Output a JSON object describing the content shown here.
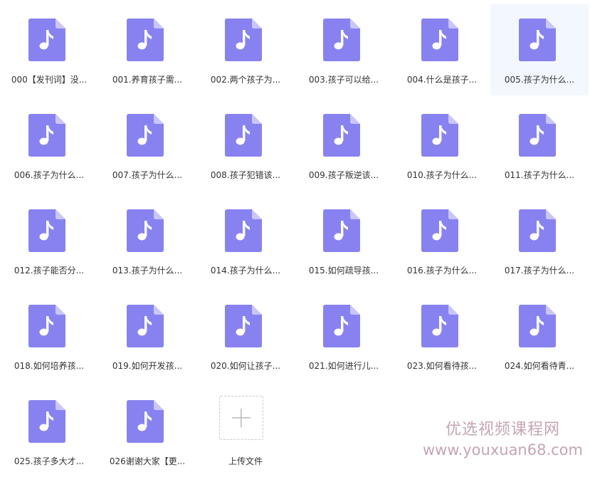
{
  "accent_color": "#8882f0",
  "files": [
    {
      "label": "000【发刊词】没..."
    },
    {
      "label": "001.养育孩子需..."
    },
    {
      "label": "002.两个孩子为..."
    },
    {
      "label": "003.孩子可以给..."
    },
    {
      "label": "004.什么是孩子..."
    },
    {
      "label": "005.孩子为什么...",
      "selected": true
    },
    {
      "label": "006.孩子为什么..."
    },
    {
      "label": "007.孩子为什么..."
    },
    {
      "label": "008.孩子犯错该..."
    },
    {
      "label": "009.孩子叛逆该..."
    },
    {
      "label": "010.孩子为什么..."
    },
    {
      "label": "011.孩子为什么..."
    },
    {
      "label": "012.孩子能否分..."
    },
    {
      "label": "013.孩子为什么..."
    },
    {
      "label": "014.孩子为什么..."
    },
    {
      "label": "015.如何疏导孩..."
    },
    {
      "label": "016.孩子为什么..."
    },
    {
      "label": "017.孩子为什么..."
    },
    {
      "label": "018.如何培养孩..."
    },
    {
      "label": "019.如何开发孩..."
    },
    {
      "label": "020.如何让孩子..."
    },
    {
      "label": "021.如何进行儿..."
    },
    {
      "label": "023.如何看待孩..."
    },
    {
      "label": "024.如何看待青..."
    },
    {
      "label": "025.孩子多大才..."
    },
    {
      "label": "026谢谢大家【更..."
    }
  ],
  "upload": {
    "label": "上传文件",
    "icon": "plus-icon"
  },
  "watermark": {
    "line1": "优选视频课程网",
    "line2": "www.youxuan68.com"
  }
}
